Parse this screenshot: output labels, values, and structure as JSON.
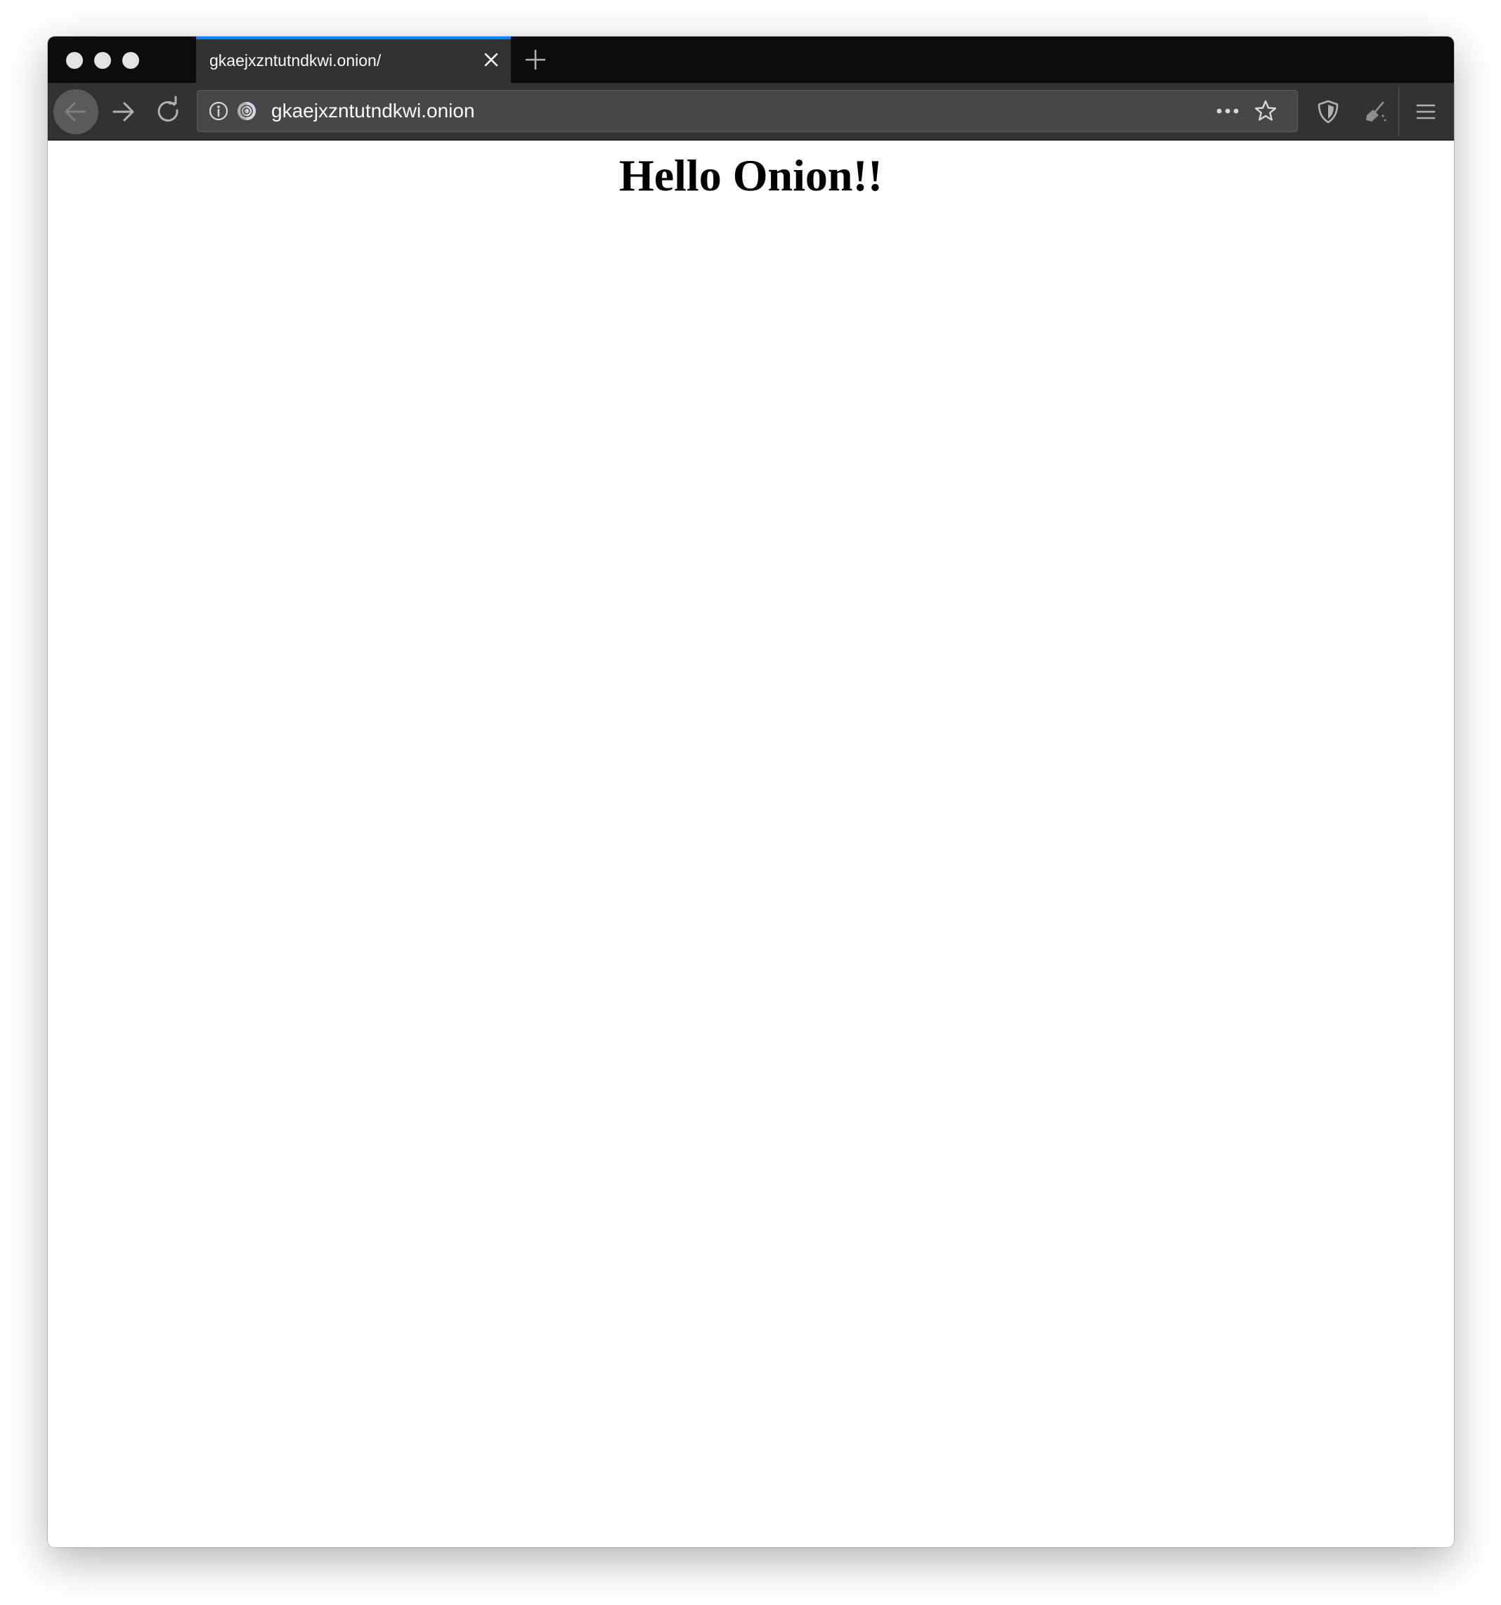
{
  "browser": {
    "tab": {
      "title": "gkaejxzntutndkwi.onion/",
      "active_indicator_color": "#0a84ff"
    },
    "urlbar": {
      "url": "gkaejxzntutndkwi.onion"
    },
    "icons": {
      "back": "back-arrow-icon",
      "forward": "forward-arrow-icon",
      "reload": "reload-icon",
      "info": "info-icon",
      "onion": "onion-icon",
      "more": "more-actions-icon",
      "bookmark": "bookmark-star-icon",
      "shield": "security-shield-icon",
      "new_identity": "broom-icon",
      "menu": "hamburger-menu-icon",
      "close_tab": "close-icon",
      "new_tab": "plus-icon"
    }
  },
  "page": {
    "heading": "Hello Onion!!"
  }
}
